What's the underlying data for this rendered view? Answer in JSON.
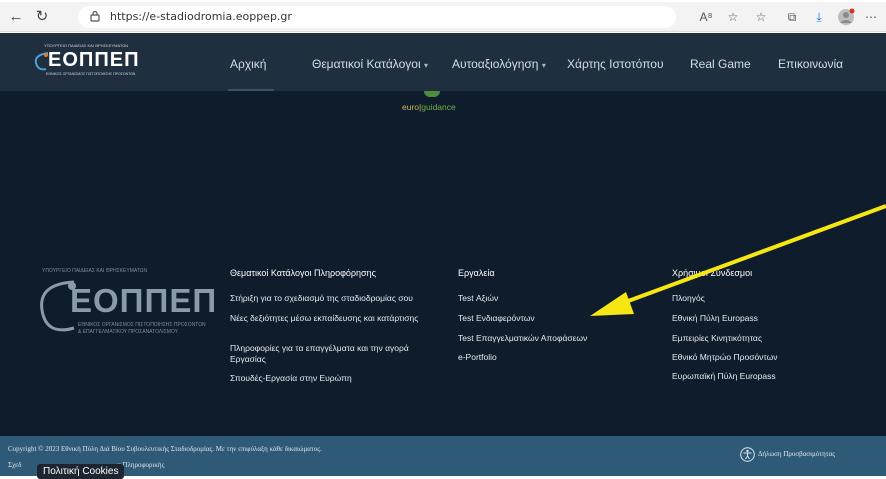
{
  "browser": {
    "url": "https://e-stadiodromia.eoppep.gr",
    "back_icon": "arrow-left-icon",
    "refresh_icon": "refresh-icon"
  },
  "header": {
    "logo_tiny": "ΥΠΟΥΡΓΕΙΟ ΠΑΙΔΕΙΑΣ ΚΑΙ ΘΡΗΣΚΕΥΜΑΤΩΝ",
    "logo_main": "ΕΟΠΠΕΠ",
    "logo_sub": "ΕΘΝΙΚΟΣ ΟΡΓΑΝΙΣΜΟΣ ΠΙΣΤΟΠΟΙΗΣΗΣ ΠΡΟΣΟΝΤΩΝ",
    "menu": [
      {
        "label": "Αρχική"
      },
      {
        "label": "Θεματικοί Κατάλογοι"
      },
      {
        "label": "Αυτοαξιολόγηση"
      },
      {
        "label": "Χάρτης Ιστοτόπου"
      },
      {
        "label": "Real Game"
      },
      {
        "label": "Επικοινωνία"
      }
    ]
  },
  "content": {
    "euro_part": "euro",
    "sep": "|",
    "guidance_part": "guidance"
  },
  "footer_logo": {
    "tiny": "ΥΠΟΥΡΓΕΙΟ ΠΑΙΔΕΙΑΣ ΚΑΙ ΘΡΗΣΚΕΥΜΑΤΩΝ",
    "main": "ΕΟΠΠΕΠ",
    "sub1": "ΕΘΝΙΚΟΣ ΟΡΓΑΝΙΣΜΟΣ ΠΙΣΤΟΠΟΙΗΣΗΣ ΠΡΟΣΟΝΤΩΝ",
    "sub2": "& ΕΠΑΓΓΕΛΜΑΤΙΚΟΥ ΠΡΟΣΑΝΑΤΟΛΙΣΜΟΥ"
  },
  "footer": {
    "col1": {
      "title": "Θεματικοί Κατάλογοι Πληροφόρησης",
      "links": [
        "Στήριξη για το σχεδιασμό της σταδιοδρομίας σου",
        "Νέες δεξιότητες μέσω εκπαίδευσης και κατάρτισης",
        "Πληροφορίες για τα επαγγέλματα και την αγορά Εργασίας",
        "Σπουδές-Εργασία στην Ευρώπη"
      ]
    },
    "col2": {
      "title": "Εργαλεία",
      "links": [
        "Test Αξιών",
        "Test Ενδιαφερόντων",
        "Test Επαγγελματικών Αποφάσεων",
        "e-Portfolio"
      ]
    },
    "col3": {
      "title": "Χρήσιμοι Σύνδεσμοι",
      "links": [
        "Πλοηγός",
        "Εθνική Πύλη Europass",
        "Εμπειρίες Κινητικότητας",
        "Εθνικό Μητρώο Προσόντων",
        "Ευρωπαϊκή Πύλη Europass"
      ]
    }
  },
  "bottom": {
    "copyright": "Copyright © 2023 Εθνική Πύλη Διά Βίου Συβουλευτικής Σταδιοδρομίας. Με την επιφύλαξη κάθε δικαιώματος.",
    "sxed": "Σχεδ",
    "sxed_rest": "α Πληροφορικής",
    "cookies": "Πολιτική Cookies",
    "accessibility": "Δήλωση Προσβασιμότητας"
  },
  "colors": {
    "annotation_arrow": "#f5e614"
  }
}
